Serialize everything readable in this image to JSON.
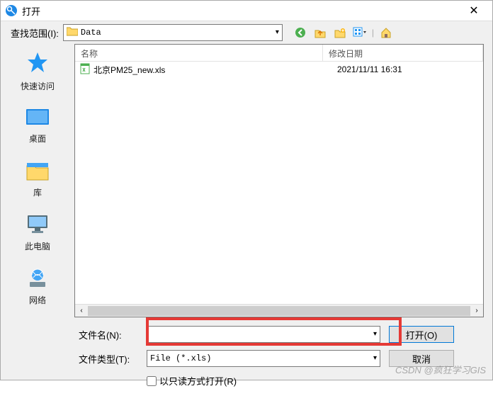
{
  "titlebar": {
    "title": "打开"
  },
  "lookIn": {
    "label": "查找范围(I):",
    "folder": "Data"
  },
  "nav": {
    "back_icon": "back-icon",
    "up_icon": "up-folder-icon",
    "new_icon": "new-folder-icon",
    "view_icon": "view-menu-icon",
    "tool_icon": "home-icon"
  },
  "sidebar": {
    "items": [
      {
        "label": "快速访问",
        "key": "quick-access"
      },
      {
        "label": "桌面",
        "key": "desktop"
      },
      {
        "label": "库",
        "key": "libraries"
      },
      {
        "label": "此电脑",
        "key": "this-pc"
      },
      {
        "label": "网络",
        "key": "network"
      }
    ]
  },
  "columns": {
    "name": "名称",
    "date": "修改日期"
  },
  "files": [
    {
      "name": "北京PM25_new.xls",
      "modified": "2021/11/11 16:31"
    }
  ],
  "form": {
    "filename_label": "文件名(N):",
    "filename_value": "",
    "filetype_label": "文件类型(T):",
    "filetype_value": "File (*.xls)",
    "open_btn": "打开(O)",
    "cancel_btn": "取消",
    "readonly_label": "以只读方式打开(R)"
  },
  "watermark": "CSDN @疯狂学习GIS"
}
